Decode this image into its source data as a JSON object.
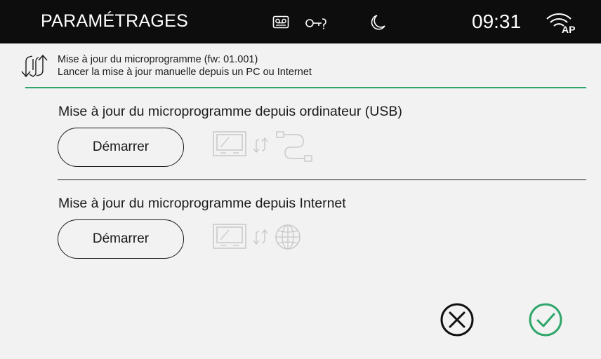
{
  "topbar": {
    "title": "PARAMÉTRAGES",
    "time": "09:31",
    "status_icons": [
      "voicemail-icon",
      "key-icon",
      "moon-icon",
      "wifi-ap-icon"
    ],
    "wifi_badge": "AP"
  },
  "firmware": {
    "icon": "update-arrows-icon",
    "line1": "Mise à jour du microprogramme (fw: 01.001)",
    "line2": "Lancer la mise à jour manuelle depuis un PC ou Internet"
  },
  "usb_section": {
    "title": "Mise à jour du microprogramme depuis ordinateur (USB)",
    "button_label": "Démarrer",
    "diagram_icons": [
      "monitor-icon",
      "sync-icon",
      "usb-cable-icon"
    ]
  },
  "internet_section": {
    "title": "Mise à jour du microprogramme depuis Internet",
    "button_label": "Démarrer",
    "diagram_icons": [
      "monitor-icon",
      "sync-icon",
      "globe-icon"
    ]
  },
  "actions": {
    "cancel_icon": "cancel-icon",
    "confirm_icon": "confirm-icon"
  },
  "colors": {
    "topbar_bg": "#0d0d0d",
    "background": "#f2f2f2",
    "accent_green": "#2fa66a",
    "disabled_icon": "#c8c8c8"
  }
}
